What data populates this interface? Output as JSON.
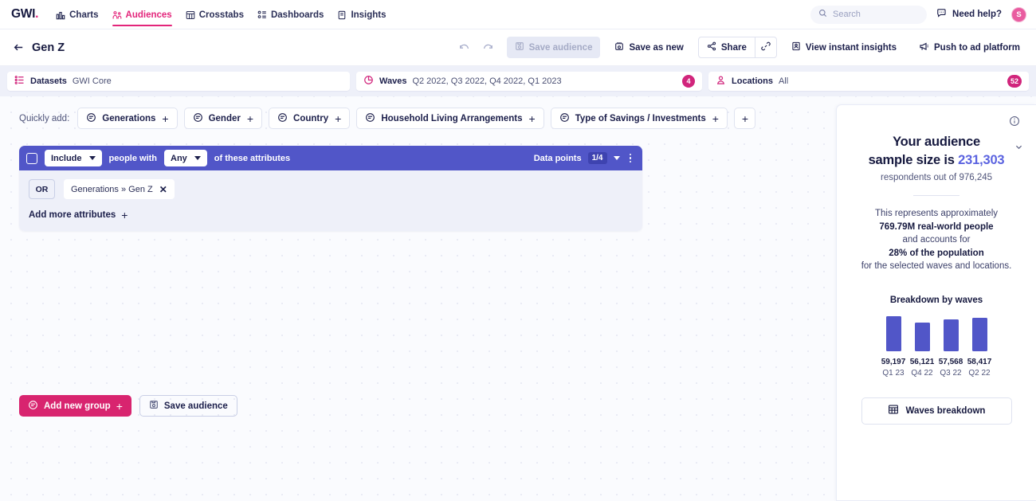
{
  "topnav": {
    "logo": "GWI",
    "logo_dot": ".",
    "items": [
      {
        "label": "Charts",
        "icon": "bar-chart-icon",
        "active": false
      },
      {
        "label": "Audiences",
        "icon": "audiences-icon",
        "active": true
      },
      {
        "label": "Crosstabs",
        "icon": "table-icon",
        "active": false
      },
      {
        "label": "Dashboards",
        "icon": "dashboard-icon",
        "active": false
      },
      {
        "label": "Insights",
        "icon": "insights-icon",
        "active": false
      }
    ],
    "search_placeholder": "Search",
    "need_help": "Need help?",
    "avatar_initial": "S"
  },
  "actionbar": {
    "title": "Gen Z",
    "undo": "undo-icon",
    "redo": "redo-icon",
    "save_audience": "Save audience",
    "save_as_new": "Save as new",
    "share": "Share",
    "copy_link": "link-icon",
    "view_instant_insights": "View instant insights",
    "push_to_ad_platform": "Push to ad platform"
  },
  "databar": {
    "datasets_label": "Datasets",
    "datasets_value": "GWI Core",
    "waves_label": "Waves",
    "waves_value": "Q2 2022, Q3 2022, Q4 2022, Q1 2023",
    "waves_count": "4",
    "locations_label": "Locations",
    "locations_value": "All",
    "locations_count": "52"
  },
  "quickadd": {
    "label": "Quickly add:",
    "chips": [
      {
        "label": "Generations"
      },
      {
        "label": "Gender"
      },
      {
        "label": "Country"
      },
      {
        "label": "Household Living Arrangements"
      },
      {
        "label": "Type of Savings / Investments"
      }
    ],
    "plus": "+"
  },
  "group": {
    "include_label": "Include",
    "people_with": "people with",
    "any_label": "Any",
    "of_these_attributes": "of these attributes",
    "data_points_label": "Data points",
    "data_points_value": "1/4",
    "operator": "OR",
    "attribute": "Generations » Gen Z",
    "attribute_remove": "✕",
    "add_more": "Add more attributes",
    "plus": "+"
  },
  "actions": {
    "add_new_group": "Add new group",
    "save_audience": "Save audience",
    "plus": "+"
  },
  "sidepanel": {
    "title_line1": "Your audience",
    "title_line2_prefix": "sample size is ",
    "sample_size": "231,303",
    "respondents": "respondents out of 976,245",
    "desc_line1": "This represents approximately",
    "desc_line2": "769.79M real-world people",
    "desc_line3": "and accounts for",
    "desc_line4": "28% of the population",
    "desc_line5": "for the selected waves and locations.",
    "breakdown_title": "Breakdown by waves",
    "waves_breakdown_button": "Waves breakdown",
    "info_icon": "info-icon",
    "collapse_icon": "chevron-down-icon"
  },
  "chart_data": {
    "type": "bar",
    "title": "Breakdown by waves",
    "categories": [
      "Q1 23",
      "Q4 22",
      "Q3 22",
      "Q2 22"
    ],
    "values": [
      59197,
      56121,
      57568,
      58417
    ],
    "value_labels": [
      "59,197",
      "56,121",
      "57,568",
      "58,417"
    ],
    "xlabel": "",
    "ylabel": "",
    "ylim": [
      0,
      59197
    ],
    "grid": false,
    "legend": false,
    "bar_color": "#5156c8"
  },
  "colors": {
    "brand_pink": "#e3257b",
    "accent_magenta": "#d8246f",
    "purple": "#5156c8",
    "blue_number": "#5b63e0",
    "ink": "#16193f"
  }
}
